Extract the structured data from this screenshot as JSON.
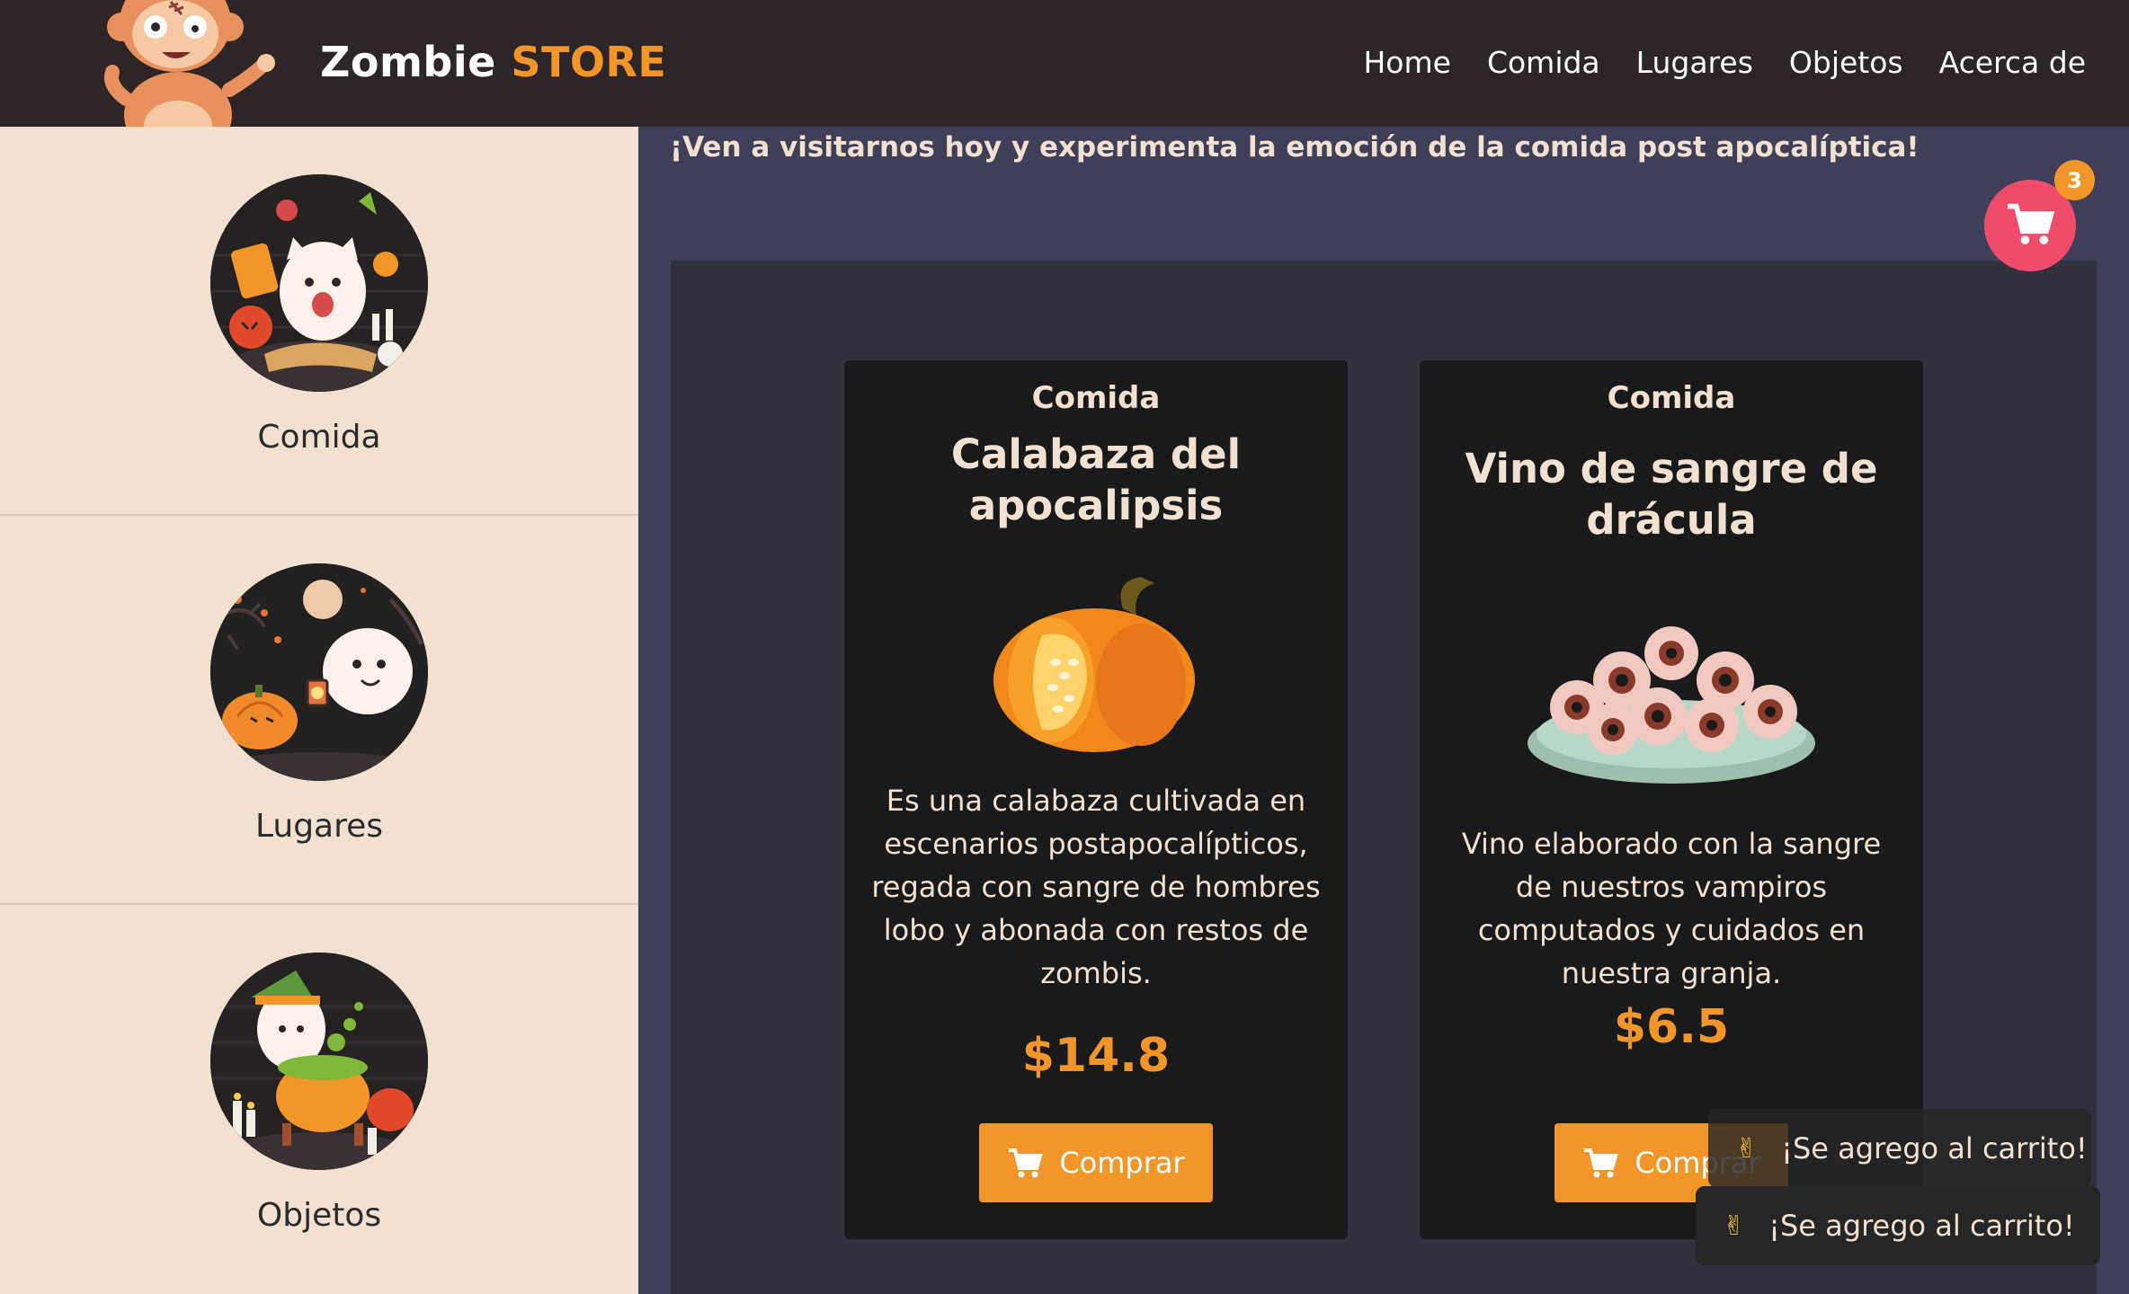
{
  "header": {
    "brand_primary": "Zombie",
    "brand_accent": "STORE",
    "nav": [
      "Home",
      "Comida",
      "Lugares",
      "Objetos",
      "Acerca de"
    ]
  },
  "sidebar": {
    "items": [
      {
        "label": "Comida",
        "icon": "ghost-cat-potion-icon"
      },
      {
        "label": "Lugares",
        "icon": "ghost-pumpkin-moon-icon"
      },
      {
        "label": "Objetos",
        "icon": "witch-ghost-cauldron-icon"
      }
    ]
  },
  "main": {
    "promo": "¡Ven a visitarnos hoy y experimenta la emoción de la comida post apocalíptica!",
    "products": [
      {
        "category": "Comida",
        "title": "Calabaza del apocalipsis",
        "description": "Es una calabaza cultivada en escenarios postapocalípticos, regada con sangre de hombres lobo y abonada con restos de zombis.",
        "price": "$14.8",
        "button": "Comprar"
      },
      {
        "category": "Comida",
        "title": "Vino de sangre de drácula",
        "description": "Vino elaborado con la sangre de nuestros vampiros computados y cuidados en nuestra granja.",
        "price": "$6.5",
        "button": "Comprar"
      }
    ]
  },
  "cart": {
    "count": "3"
  },
  "toasts": [
    {
      "message": "¡Se agrego al carrito!"
    },
    {
      "message": "¡Se agrego al carrito!"
    }
  ],
  "colors": {
    "header_bg": "#2e2626",
    "accent": "#f3962a",
    "sidebar_bg": "#f2e1d0",
    "main_bg": "#3f3f59",
    "card_bg": "#1a1a1a",
    "cart_button": "#ef4c6b"
  }
}
